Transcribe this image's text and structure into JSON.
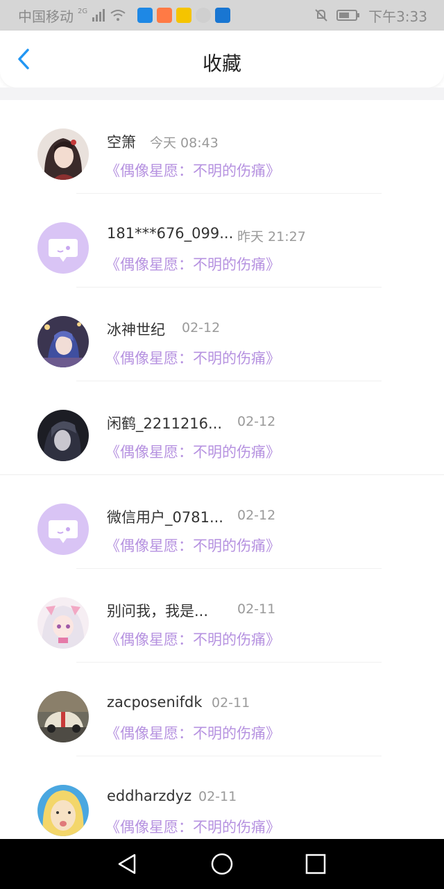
{
  "status_bar": {
    "carrier": "中国移动",
    "network": "2G",
    "time": "下午3:33"
  },
  "header": {
    "title": "收藏"
  },
  "favorites": [
    {
      "name": "空箫",
      "time": "今天 08:43",
      "book": "《偶像星愿：不明的伤痛》",
      "avatar": "anime-girl-avatar"
    },
    {
      "name": "181***676_099...",
      "time": "昨天 21:27",
      "book": "《偶像星愿：不明的伤痛》",
      "avatar": "default-chat-avatar"
    },
    {
      "name": "冰神世纪",
      "time": "02-12",
      "book": "《偶像星愿：不明的伤痛》",
      "avatar": "anime-boy-avatar"
    },
    {
      "name": "闲鹤_2211216...",
      "time": "02-12",
      "book": "《偶像星愿：不明的伤痛》",
      "avatar": "dark-anime-avatar"
    },
    {
      "name": "微信用户_0781...",
      "time": "02-12",
      "book": "《偶像星愿：不明的伤痛》",
      "avatar": "default-chat-avatar"
    },
    {
      "name": "别问我，我是...",
      "time": "02-11",
      "book": "《偶像星愿：不明的伤痛》",
      "avatar": "pink-anime-avatar"
    },
    {
      "name": "zacposenifdk",
      "time": "02-11",
      "book": "《偶像星愿：不明的伤痛》",
      "avatar": "car-photo-avatar"
    },
    {
      "name": "eddharzdyz",
      "time": "02-11",
      "book": "《偶像星愿：不明的伤痛》",
      "avatar": "cartoon-face-avatar"
    }
  ],
  "colors": {
    "accent_blue": "#2196f3",
    "book_purple": "#b692e0",
    "default_avatar_bg": "#d9c4f5"
  }
}
